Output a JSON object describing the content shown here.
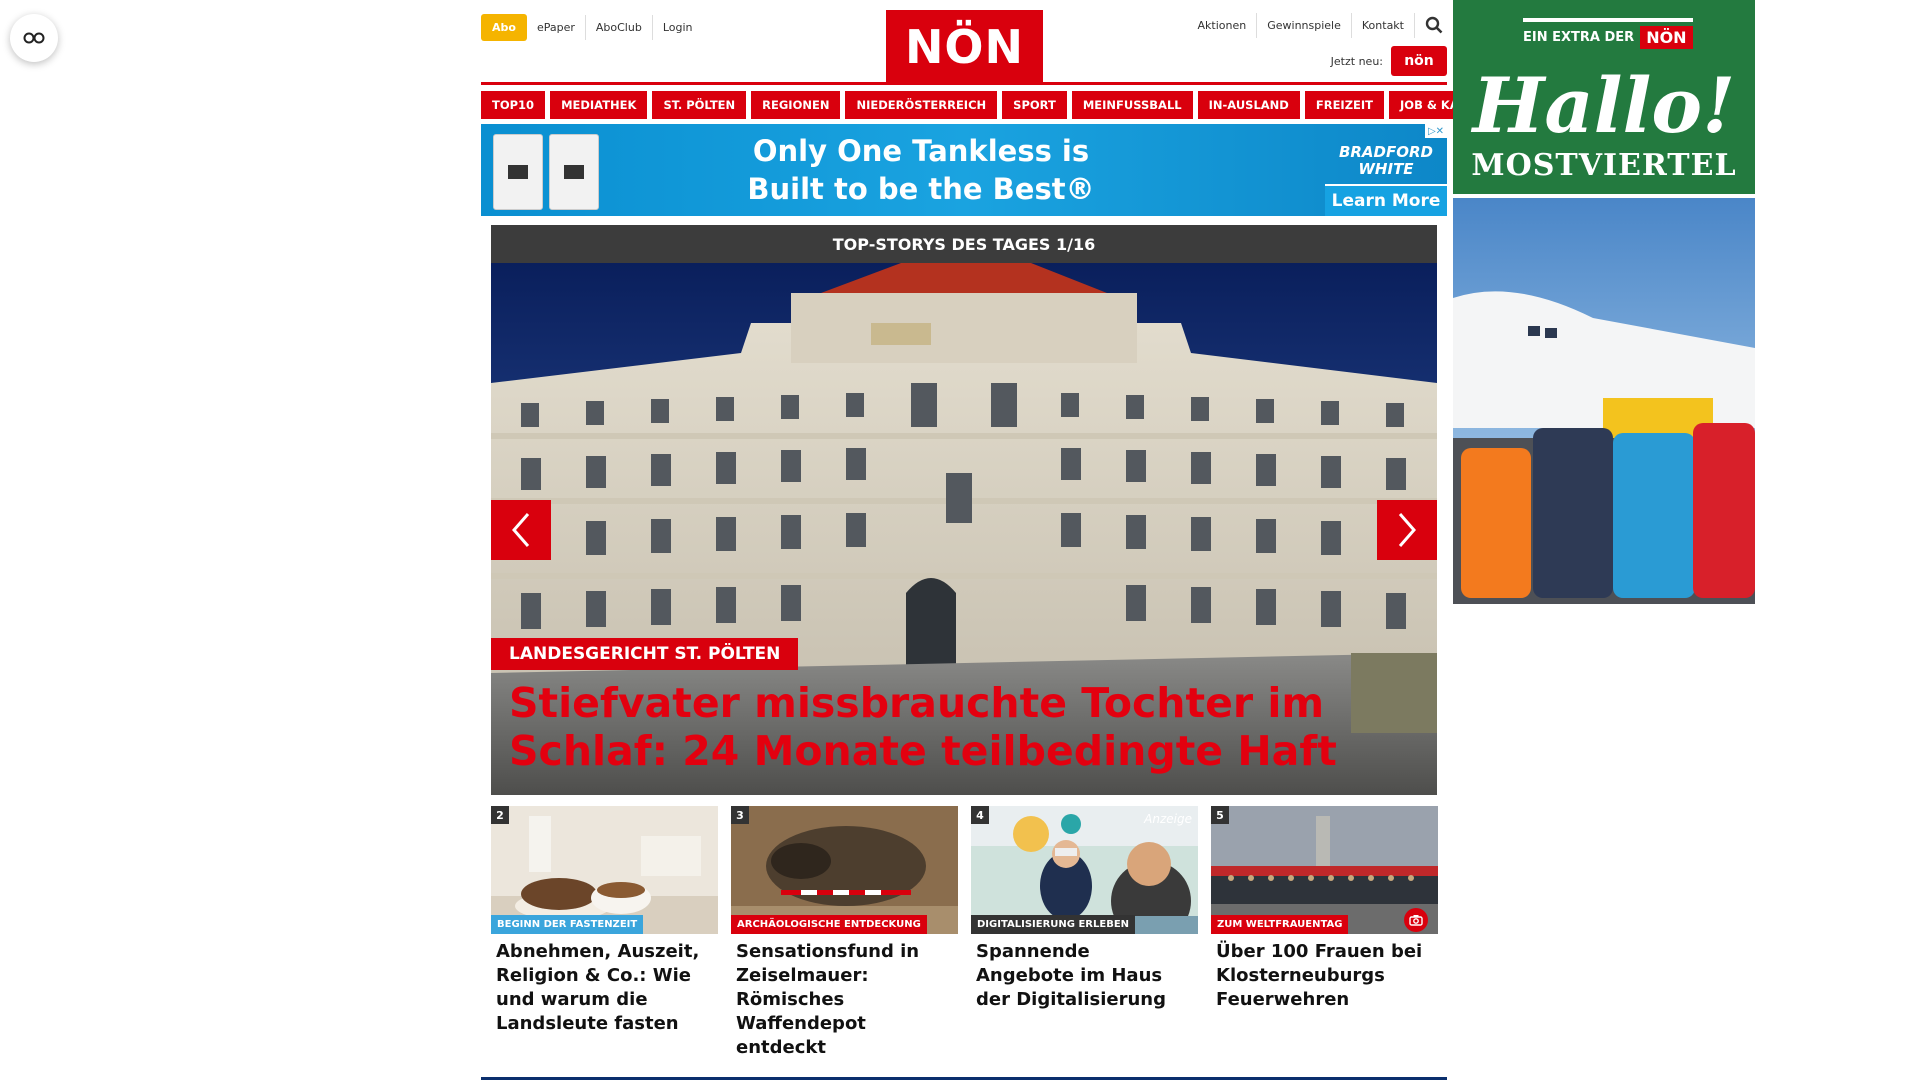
{
  "top_links_left": {
    "abo": "Abo",
    "epaper": "ePaper",
    "aboclub": "AboClub",
    "login": "Login"
  },
  "logo": {
    "text": "NÖN"
  },
  "top_links_right": {
    "aktionen": "Aktionen",
    "gewinnspiele": "Gewinnspiele",
    "kontakt": "Kontakt"
  },
  "jetzt": {
    "label": "Jetzt neu:",
    "badge": "nön"
  },
  "main_nav": [
    "TOP10",
    "MEDIATHEK",
    "ST. PÖLTEN",
    "REGIONEN",
    "NIEDERÖSTERREICH",
    "SPORT",
    "MEINFUSSBALL",
    "IN-AUSLAND",
    "FREIZEIT",
    "JOB & KARRIERE"
  ],
  "ad_banner": {
    "headline_1": "Only One Tankless is",
    "headline_2": "Built to be the Best®",
    "brand_1": "BRADFORD",
    "brand_2": "WHITE",
    "cta": "Learn More"
  },
  "hero": {
    "header": "TOP-STORYS DES TAGES 1/16",
    "kicker": "LANDESGERICHT ST. PÖLTEN",
    "title": "Stiefvater missbrauchte Tochter im Schlaf: 24 Monate teilbedingte Haft"
  },
  "teasers": [
    {
      "num": "2",
      "kicker": "BEGINN DER FASTENZEIT",
      "kicker_color": "#3aa5dc",
      "title": "Abnehmen, Auszeit, Religion & Co.: Wie und warum die Landsleute fasten"
    },
    {
      "num": "3",
      "kicker": "ARCHÄOLOGISCHE ENTDECKUNG",
      "kicker_color": "#d9000d",
      "title": "Sensationsfund in Zeiselmauer: Römisches Waffendepot entdeckt"
    },
    {
      "num": "4",
      "kicker": "DIGITALISIERUNG ERLEBEN",
      "kicker_color": "#333333",
      "anzeige": "Anzeige",
      "title": "Spannende Angebote im Haus der Digitalisierung"
    },
    {
      "num": "5",
      "kicker": "ZUM WELTFRAUENTAG",
      "kicker_color": "#d9000d",
      "title": "Über 100 Frauen bei Klosterneuburgs Feuerwehren"
    }
  ],
  "side_ad": {
    "extra": "EIN EXTRA DER",
    "noen": "NÖN",
    "hallo": "Hallo!",
    "region": "MOSTVIERTEL"
  },
  "colors": {
    "brand_red": "#d9000d",
    "abo_yellow": "#f5b400",
    "dark_header": "#3c3c3c",
    "side_green": "#237a3f"
  }
}
